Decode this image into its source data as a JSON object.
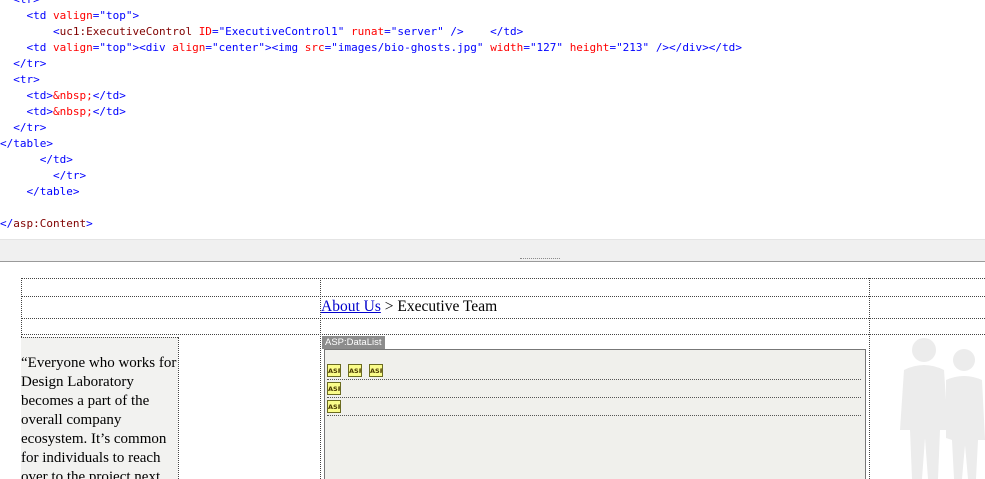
{
  "code": {
    "lines": [
      [
        [
          "tok-tag",
          "  <"
        ],
        [
          "tok-tag",
          "tr"
        ],
        [
          "tok-tag",
          ">"
        ]
      ],
      [
        [
          "tok-txt",
          "    "
        ],
        [
          "tok-tag",
          "<"
        ],
        [
          "tok-tag",
          "td"
        ],
        [
          "tok-txt",
          " "
        ],
        [
          "tok-attr",
          "valign"
        ],
        [
          "tok-tag",
          "="
        ],
        [
          "tok-val",
          "\"top\""
        ],
        [
          "tok-tag",
          ">"
        ]
      ],
      [
        [
          "tok-txt",
          "        "
        ],
        [
          "tok-tag",
          "<"
        ],
        [
          "tok-asp",
          "uc1:ExecutiveControl"
        ],
        [
          "tok-txt",
          " "
        ],
        [
          "tok-attr",
          "ID"
        ],
        [
          "tok-tag",
          "="
        ],
        [
          "tok-val",
          "\"ExecutiveControl1\""
        ],
        [
          "tok-txt",
          " "
        ],
        [
          "tok-attr",
          "runat"
        ],
        [
          "tok-tag",
          "="
        ],
        [
          "tok-val",
          "\"server\""
        ],
        [
          "tok-txt",
          " "
        ],
        [
          "tok-tag",
          "/>"
        ],
        [
          "tok-txt",
          "    "
        ],
        [
          "tok-tag",
          "</"
        ],
        [
          "tok-tag",
          "td"
        ],
        [
          "tok-tag",
          ">"
        ]
      ],
      [
        [
          "tok-txt",
          "    "
        ],
        [
          "tok-tag",
          "<"
        ],
        [
          "tok-tag",
          "td"
        ],
        [
          "tok-txt",
          " "
        ],
        [
          "tok-attr",
          "valign"
        ],
        [
          "tok-tag",
          "="
        ],
        [
          "tok-val",
          "\"top\""
        ],
        [
          "tok-tag",
          "><"
        ],
        [
          "tok-tag",
          "div"
        ],
        [
          "tok-txt",
          " "
        ],
        [
          "tok-attr",
          "align"
        ],
        [
          "tok-tag",
          "="
        ],
        [
          "tok-val",
          "\"center\""
        ],
        [
          "tok-tag",
          "><"
        ],
        [
          "tok-tag",
          "img"
        ],
        [
          "tok-txt",
          " "
        ],
        [
          "tok-attr",
          "src"
        ],
        [
          "tok-tag",
          "="
        ],
        [
          "tok-val",
          "\"images/bio-ghosts.jpg\""
        ],
        [
          "tok-txt",
          " "
        ],
        [
          "tok-attr",
          "width"
        ],
        [
          "tok-tag",
          "="
        ],
        [
          "tok-val",
          "\"127\""
        ],
        [
          "tok-txt",
          " "
        ],
        [
          "tok-attr",
          "height"
        ],
        [
          "tok-tag",
          "="
        ],
        [
          "tok-val",
          "\"213\""
        ],
        [
          "tok-txt",
          " "
        ],
        [
          "tok-tag",
          "/></"
        ],
        [
          "tok-tag",
          "div"
        ],
        [
          "tok-tag",
          "></"
        ],
        [
          "tok-tag",
          "td"
        ],
        [
          "tok-tag",
          ">"
        ]
      ],
      [
        [
          "tok-txt",
          "  "
        ],
        [
          "tok-tag",
          "</"
        ],
        [
          "tok-tag",
          "tr"
        ],
        [
          "tok-tag",
          ">"
        ]
      ],
      [
        [
          "tok-txt",
          "  "
        ],
        [
          "tok-tag",
          "<"
        ],
        [
          "tok-tag",
          "tr"
        ],
        [
          "tok-tag",
          ">"
        ]
      ],
      [
        [
          "tok-txt",
          "    "
        ],
        [
          "tok-tag",
          "<"
        ],
        [
          "tok-tag",
          "td"
        ],
        [
          "tok-tag",
          ">"
        ],
        [
          "tok-ent",
          "&nbsp;"
        ],
        [
          "tok-tag",
          "</"
        ],
        [
          "tok-tag",
          "td"
        ],
        [
          "tok-tag",
          ">"
        ]
      ],
      [
        [
          "tok-txt",
          "    "
        ],
        [
          "tok-tag",
          "<"
        ],
        [
          "tok-tag",
          "td"
        ],
        [
          "tok-tag",
          ">"
        ],
        [
          "tok-ent",
          "&nbsp;"
        ],
        [
          "tok-tag",
          "</"
        ],
        [
          "tok-tag",
          "td"
        ],
        [
          "tok-tag",
          ">"
        ]
      ],
      [
        [
          "tok-txt",
          "  "
        ],
        [
          "tok-tag",
          "</"
        ],
        [
          "tok-tag",
          "tr"
        ],
        [
          "tok-tag",
          ">"
        ]
      ],
      [
        [
          "tok-tag",
          "</"
        ],
        [
          "tok-tag",
          "table"
        ],
        [
          "tok-tag",
          ">"
        ]
      ],
      [
        [
          "tok-txt",
          "      "
        ],
        [
          "tok-tag",
          "</"
        ],
        [
          "tok-tag",
          "td"
        ],
        [
          "tok-tag",
          ">"
        ]
      ],
      [
        [
          "tok-txt",
          "        "
        ],
        [
          "tok-tag",
          "</"
        ],
        [
          "tok-tag",
          "tr"
        ],
        [
          "tok-tag",
          ">"
        ]
      ],
      [
        [
          "tok-txt",
          "    "
        ],
        [
          "tok-tag",
          "</"
        ],
        [
          "tok-tag",
          "table"
        ],
        [
          "tok-tag",
          ">"
        ]
      ],
      [
        [
          "tok-txt",
          ""
        ]
      ],
      [
        [
          "tok-tag",
          "</"
        ],
        [
          "tok-asp",
          "asp:Content"
        ],
        [
          "tok-tag",
          ">"
        ]
      ]
    ]
  },
  "design": {
    "breadcrumb": {
      "link": "About Us",
      "separator": " > ",
      "current": "Executive Team"
    },
    "quote_lines": [
      "“Everyone who works for",
      "Design Laboratory",
      "becomes a part of the",
      "overall company",
      "ecosystem. It’s common",
      "for individuals to reach",
      "over to the project next"
    ],
    "datalist_label": "ASP:DataList",
    "asp_icon_text": "ASP",
    "datalist_rows": [
      3,
      1,
      1
    ]
  },
  "colors": {
    "tag": "#0000ff",
    "server_control": "#800000",
    "attribute": "#ff0000",
    "link": "#0000cc",
    "asp_icon_fill": "#fafc8a"
  }
}
